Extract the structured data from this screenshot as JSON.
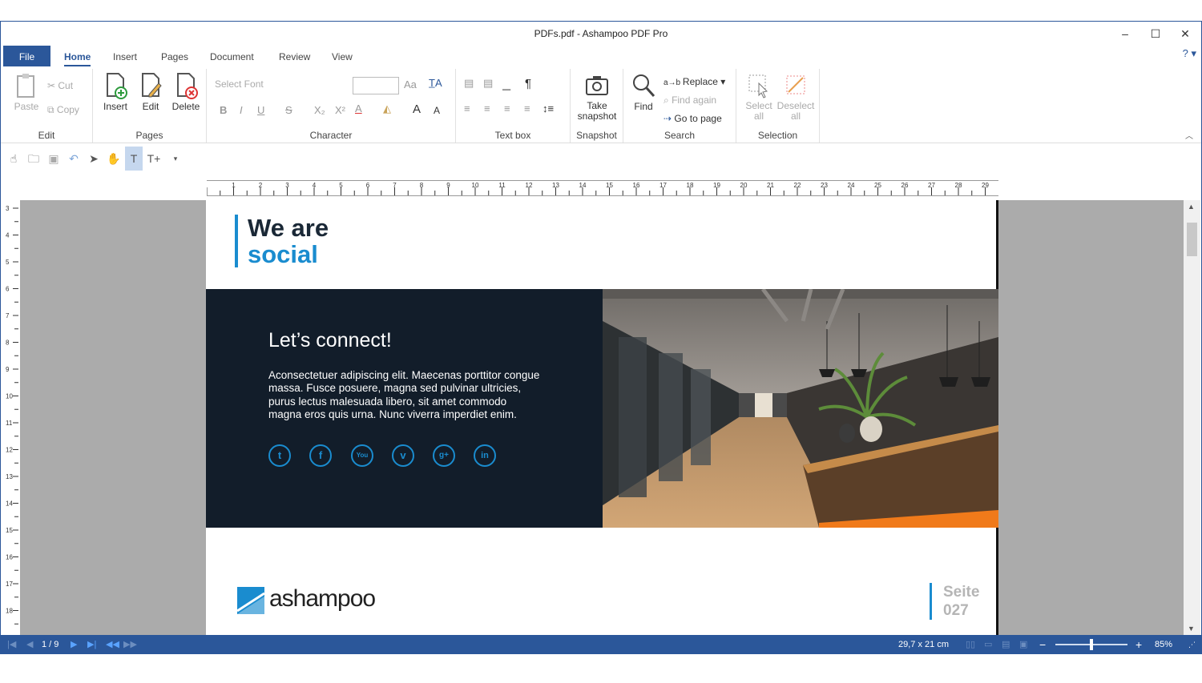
{
  "window": {
    "title": "PDFs.pdf - Ashampoo PDF Pro",
    "minimize": "–",
    "maximize": "☐",
    "close": "✕"
  },
  "menu": {
    "file": "File",
    "tabs": [
      "Home",
      "Insert",
      "Pages",
      "Document",
      "Review",
      "View"
    ],
    "active": "Home",
    "help": "? ▾"
  },
  "ribbon": {
    "edit": {
      "label": "Edit",
      "paste": "Paste",
      "cut": "Cut",
      "copy": "Copy"
    },
    "pages": {
      "label": "Pages",
      "insert": "Insert",
      "edit": "Edit",
      "delete": "Delete"
    },
    "character": {
      "label": "Character",
      "font_placeholder": "Select Font",
      "bold": "B",
      "italic": "I",
      "underline": "U",
      "strike": "S",
      "sub": "X₂",
      "sup": "X²",
      "color": "A",
      "grow": "A",
      "shrink": "A"
    },
    "textbox": {
      "label": "Text box",
      "pilcrow": "¶"
    },
    "snapshot": {
      "label": "Snapshot",
      "take": "Take snapshot"
    },
    "search": {
      "label": "Search",
      "find": "Find",
      "replace": "Replace",
      "find_again": "Find again",
      "goto": "Go to page"
    },
    "selection": {
      "label": "Selection",
      "select_all": "Select all",
      "deselect_all": "Deselect all"
    }
  },
  "document": {
    "title_line1": "We are",
    "title_line2": "social",
    "heading": "Let’s connect!",
    "body": "Aconsectetuer adipiscing elit. Maecenas porttitor congue massa. Fusce posuere, magna sed pulvinar ultricies, purus lectus malesuada libero, sit amet commodo magna eros quis urna. Nunc viverra imperdiet enim.",
    "social": [
      "t",
      "f",
      "You",
      "v",
      "g+",
      "in"
    ],
    "logo_text": "ashampoo",
    "page_label": "Seite",
    "page_number": "027"
  },
  "status": {
    "page": "1 / 9",
    "size": "29,7 x 21 cm",
    "zoom": "85%",
    "zoom_level": 0.5
  },
  "colors": {
    "accent": "#2b579a",
    "brand_blue": "#1a8ccf",
    "dark_panel": "#121d2a"
  }
}
